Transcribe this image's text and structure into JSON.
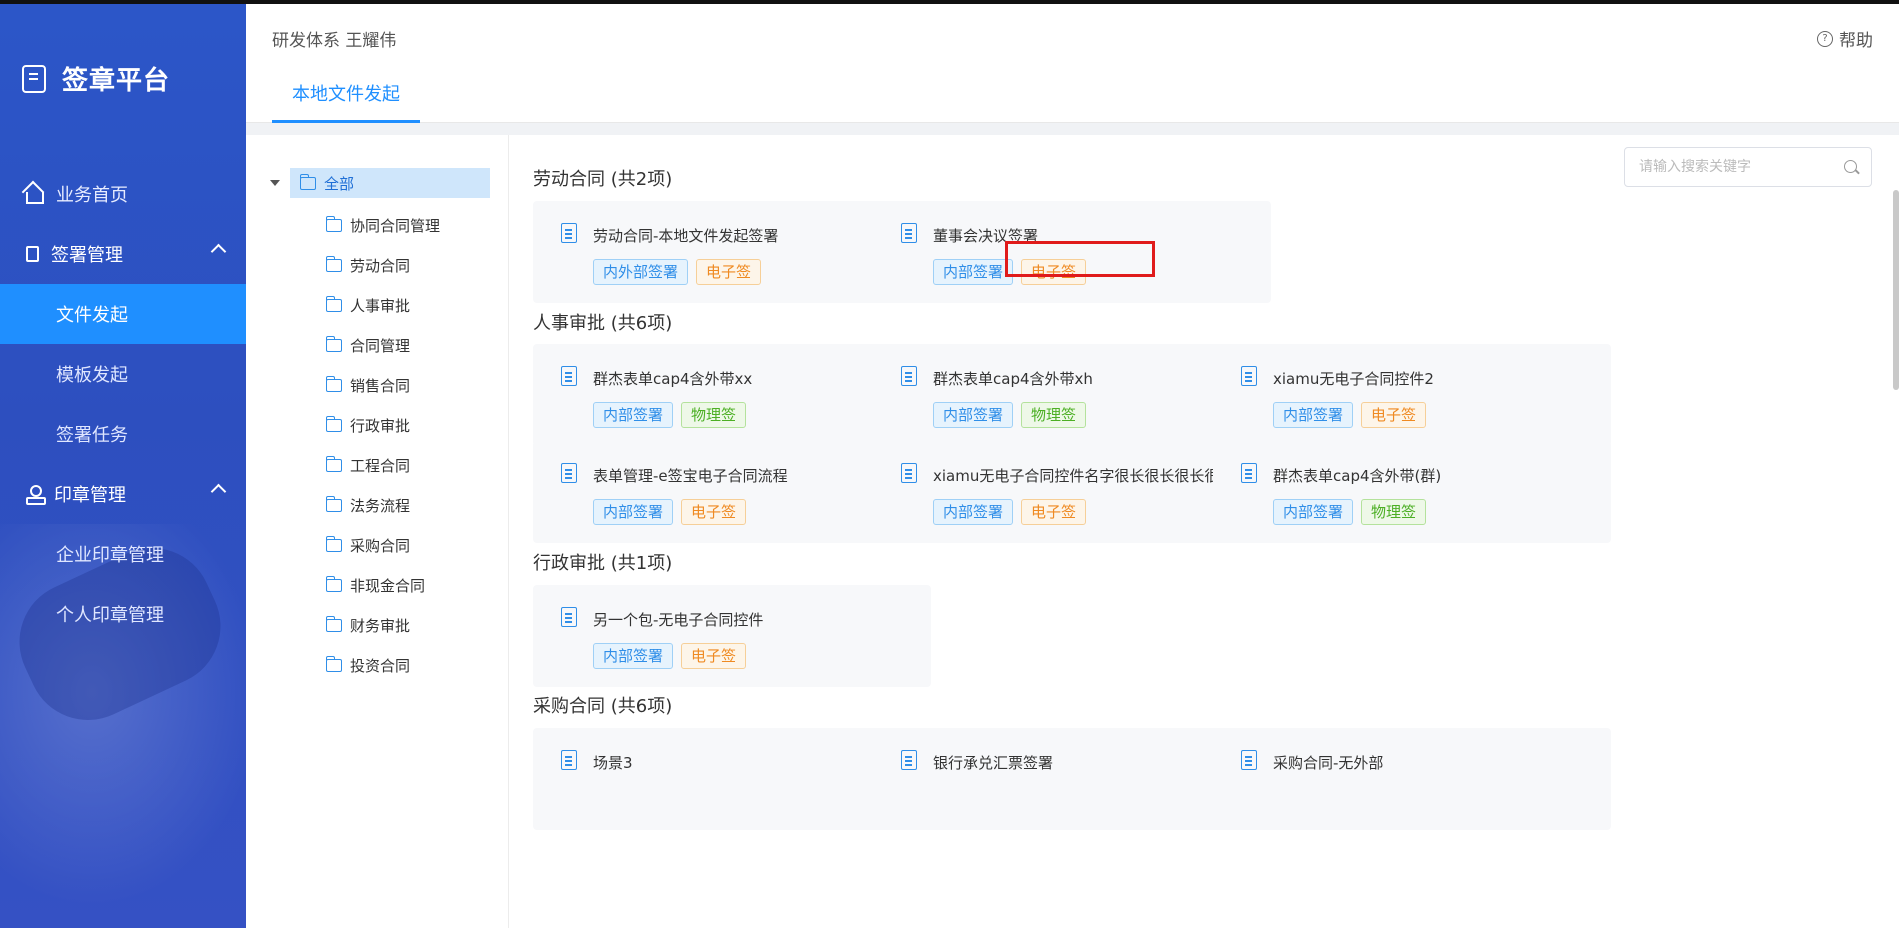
{
  "brand": {
    "title": "签章平台"
  },
  "nav": {
    "home": "业务首页",
    "sign_mgmt": "签署管理",
    "file_launch": "文件发起",
    "template_launch": "模板发起",
    "sign_task": "签署任务",
    "seal_mgmt": "印章管理",
    "ent_seal": "企业印章管理",
    "personal_seal": "个人印章管理"
  },
  "header": {
    "crumb": "研发体系 王耀伟",
    "help": "帮助"
  },
  "tabs": [
    {
      "label": "本地文件发起"
    }
  ],
  "tree": {
    "root": "全部",
    "items": [
      "协同合同管理",
      "劳动合同",
      "人事审批",
      "合同管理",
      "销售合同",
      "行政审批",
      "工程合同",
      "法务流程",
      "采购合同",
      "非现金合同",
      "财务审批",
      "投资合同"
    ]
  },
  "search": {
    "placeholder": "请输入搜索关键字"
  },
  "colors": {
    "accent": "#1f8fff",
    "sidebar": "#2c56c8",
    "highlight": "#e01b1b"
  },
  "sections": [
    {
      "title": "劳动合同 (共2项)",
      "cards": [
        {
          "name": "劳动合同-本地文件发起签署",
          "tags": [
            {
              "text": "内外部签署",
              "color": "blue"
            },
            {
              "text": "电子签",
              "color": "orange"
            }
          ]
        },
        {
          "name": "董事会决议签署",
          "tags": [
            {
              "text": "内部签署",
              "color": "blue"
            },
            {
              "text": "电子签",
              "color": "orange"
            }
          ]
        }
      ]
    },
    {
      "title": "人事审批 (共6项)",
      "cards": [
        {
          "name": "群杰表单cap4含外带xx",
          "tags": [
            {
              "text": "内部签署",
              "color": "blue"
            },
            {
              "text": "物理签",
              "color": "green"
            }
          ]
        },
        {
          "name": "群杰表单cap4含外带xh",
          "tags": [
            {
              "text": "内部签署",
              "color": "blue"
            },
            {
              "text": "物理签",
              "color": "green"
            }
          ]
        },
        {
          "name": "xiamu无电子合同控件2",
          "tags": [
            {
              "text": "内部签署",
              "color": "blue"
            },
            {
              "text": "电子签",
              "color": "orange"
            }
          ]
        },
        {
          "name": "表单管理-e签宝电子合同流程",
          "tags": [
            {
              "text": "内部签署",
              "color": "blue"
            },
            {
              "text": "电子签",
              "color": "orange"
            }
          ]
        },
        {
          "name": "xiamu无电子合同控件名字很长很长很长很长很长",
          "tags": [
            {
              "text": "内部签署",
              "color": "blue"
            },
            {
              "text": "电子签",
              "color": "orange"
            }
          ]
        },
        {
          "name": "群杰表单cap4含外带(群)",
          "tags": [
            {
              "text": "内部签署",
              "color": "blue"
            },
            {
              "text": "物理签",
              "color": "green"
            }
          ]
        }
      ]
    },
    {
      "title": "行政审批 (共1项)",
      "cards": [
        {
          "name": "另一个包-无电子合同控件",
          "tags": [
            {
              "text": "内部签署",
              "color": "blue"
            },
            {
              "text": "电子签",
              "color": "orange"
            }
          ]
        }
      ]
    },
    {
      "title": "采购合同 (共6项)",
      "cards": [
        {
          "name": "场景3",
          "tags": []
        },
        {
          "name": "银行承兑汇票签署",
          "tags": []
        },
        {
          "name": "采购合同-无外部",
          "tags": []
        }
      ]
    }
  ]
}
